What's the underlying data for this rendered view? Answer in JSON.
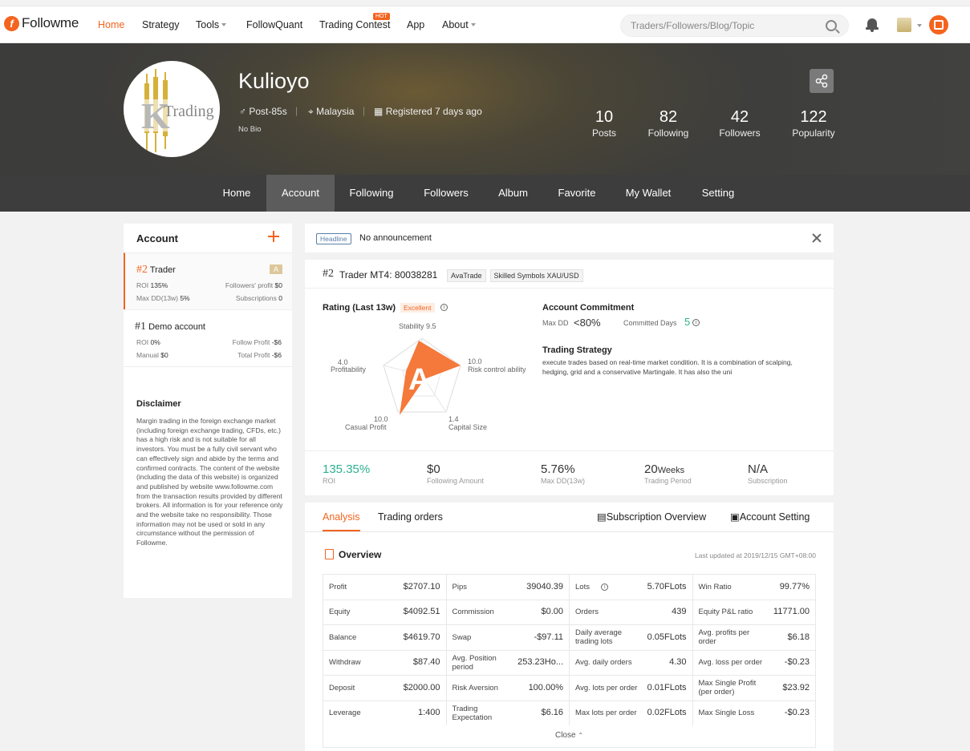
{
  "nav": {
    "logo_text": "Followme",
    "items": [
      "Home",
      "Strategy",
      "Tools",
      "FollowQuant",
      "Trading Contest",
      "App",
      "About"
    ],
    "hot_badge": "HOT",
    "search_placeholder": "Traders/Followers/Blog/Topic",
    "accent": "#f4641f"
  },
  "profile": {
    "name": "Kulioyo",
    "post": "Post-85s",
    "country": "Malaysia",
    "registered": "Registered 7 days ago",
    "bio": "No Bio",
    "avatar_text": "Trading",
    "avatar_letter": "K",
    "stats": [
      {
        "n": "10",
        "l": "Posts"
      },
      {
        "n": "82",
        "l": "Following"
      },
      {
        "n": "42",
        "l": "Followers"
      },
      {
        "n": "122",
        "l": "Popularity"
      }
    ]
  },
  "subnav": [
    "Home",
    "Account",
    "Following",
    "Followers",
    "Album",
    "Favorite",
    "My Wallet",
    "Setting"
  ],
  "left": {
    "title": "Account",
    "accounts": [
      {
        "num": "#2",
        "name": "Trader",
        "badge": "A",
        "roi_k": "ROI",
        "roi_v": "135%",
        "fp_k": "Followers' profit",
        "fp_v": "$0",
        "dd_k": "Max DD(13w)",
        "dd_v": "5%",
        "sub_k": "Subscriptions",
        "sub_v": "0"
      },
      {
        "num": "#1",
        "name": "Demo account",
        "roi_k": "ROI",
        "roi_v": "0%",
        "fp_k": "Follow Profit",
        "fp_v": "-$6",
        "dd_k": "Manual",
        "dd_v": "$0",
        "sub_k": "Total Profit",
        "sub_v": "-$6"
      }
    ],
    "disclaimer_title": "Disclaimer",
    "disclaimer": "Margin trading in the foreign exchange market (including foreign exchange trading, CFDs, etc.) has a high risk and is not suitable for all investors. You must be a fully civil servant who can effectively sign and abide by the terms and confirmed contracts. The content of the website (including the data of this website) is organized and published by website www.followme.com from the transaction results provided by different brokers. All information is for your reference only and the website take no responsibility. Those information may not be used or sold in any circumstance without the permission of Followme."
  },
  "headline": {
    "tag": "Headline",
    "text": "No announcement"
  },
  "trader": {
    "num": "#2",
    "title": "Trader MT4: 80038281",
    "broker": "AvaTrade",
    "skilled": "Skilled Symbols XAU/USD",
    "rating_title": "Rating (Last 13w)",
    "rating_badge": "Excellent",
    "grade": "A",
    "radar": [
      {
        "label": "Stability",
        "value": "9.5"
      },
      {
        "label": "Risk control ability",
        "value": "10.0"
      },
      {
        "label": "Capital Size",
        "value": "1.4"
      },
      {
        "label": "Casual Profit",
        "value": "10.0"
      },
      {
        "label": "Profitability",
        "value": "4.0"
      }
    ],
    "commit_title": "Account Commitment",
    "maxdd_k": "Max DD",
    "maxdd_v": "<80%",
    "days_k": "Committed Days",
    "days_v": "5",
    "strategy_title": "Trading Strategy",
    "strategy_text": "execute trades based on real-time market condition. It is a combination of scalping, hedging, grid and a conservative Martingale. It has also the uni",
    "metrics": [
      {
        "v": "135.35%",
        "k": "ROI"
      },
      {
        "v": "$0",
        "k": "Following Amount"
      },
      {
        "v": "5.76%",
        "k": "Max DD(13w)"
      },
      {
        "v": "20",
        "unit": "Weeks",
        "k": "Trading Period"
      },
      {
        "v": "N/A",
        "k": "Subscription"
      }
    ]
  },
  "tabs": {
    "analysis": "Analysis",
    "orders": "Trading orders",
    "sub": "Subscription Overview",
    "setting": "Account Setting"
  },
  "overview": {
    "title": "Overview",
    "updated": "Last updated at 2019/12/15 GMT+08:00",
    "close": "Close",
    "rows": [
      [
        [
          "Profit",
          "$2707.10"
        ],
        [
          "Pips",
          "39040.39"
        ],
        [
          "Lots",
          "5.70FLots"
        ],
        [
          "Win Ratio",
          "99.77%"
        ]
      ],
      [
        [
          "Equity",
          "$4092.51"
        ],
        [
          "Commission",
          "$0.00"
        ],
        [
          "Orders",
          "439"
        ],
        [
          "Equity P&L ratio",
          "11771.00"
        ]
      ],
      [
        [
          "Balance",
          "$4619.70"
        ],
        [
          "Swap",
          "-$97.11"
        ],
        [
          "Daily average trading lots",
          "0.05FLots"
        ],
        [
          "Avg. profits per order",
          "$6.18"
        ]
      ],
      [
        [
          "Withdraw",
          "$87.40"
        ],
        [
          "Avg. Position period",
          "253.23Ho..."
        ],
        [
          "Avg. daily orders",
          "4.30"
        ],
        [
          "Avg. loss per order",
          "-$0.23"
        ]
      ],
      [
        [
          "Deposit",
          "$2000.00"
        ],
        [
          "Risk Aversion",
          "100.00%"
        ],
        [
          "Avg. lots per order",
          "0.01FLots"
        ],
        [
          "Max Single Profit (per order)",
          "$23.92"
        ]
      ],
      [
        [
          "Leverage",
          "1:400"
        ],
        [
          "Trading Expectation",
          "$6.16"
        ],
        [
          "Max lots per order",
          "0.02FLots"
        ],
        [
          "Max Single Loss",
          "-$0.23"
        ]
      ]
    ]
  }
}
